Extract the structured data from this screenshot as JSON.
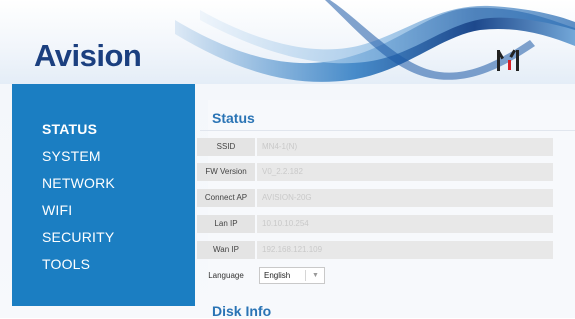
{
  "header": {
    "logo_text": "Avision",
    "brand_mark": "M",
    "colors": {
      "logo": "#1b3f7f",
      "wave": "#1d6fb3"
    }
  },
  "sidebar": {
    "background": "#1b7ec2",
    "items": [
      {
        "label": "STATUS",
        "active": true
      },
      {
        "label": "SYSTEM",
        "active": false
      },
      {
        "label": "NETWORK",
        "active": false
      },
      {
        "label": "WIFI",
        "active": false
      },
      {
        "label": "SECURITY",
        "active": false
      },
      {
        "label": "TOOLS",
        "active": false
      }
    ]
  },
  "status": {
    "title": "Status",
    "rows": [
      {
        "label": "SSID",
        "value": "MN4-1(N)"
      },
      {
        "label": "FW Version",
        "value": "V0_2.2.182"
      },
      {
        "label": "Connect AP",
        "value": "AVISION-20G"
      },
      {
        "label": "Lan IP",
        "value": "10.10.10.254"
      },
      {
        "label": "Wan IP",
        "value": "192.168.121.109"
      }
    ],
    "language": {
      "label": "Language",
      "selected": "English"
    }
  },
  "disk": {
    "title": "Disk Info"
  }
}
